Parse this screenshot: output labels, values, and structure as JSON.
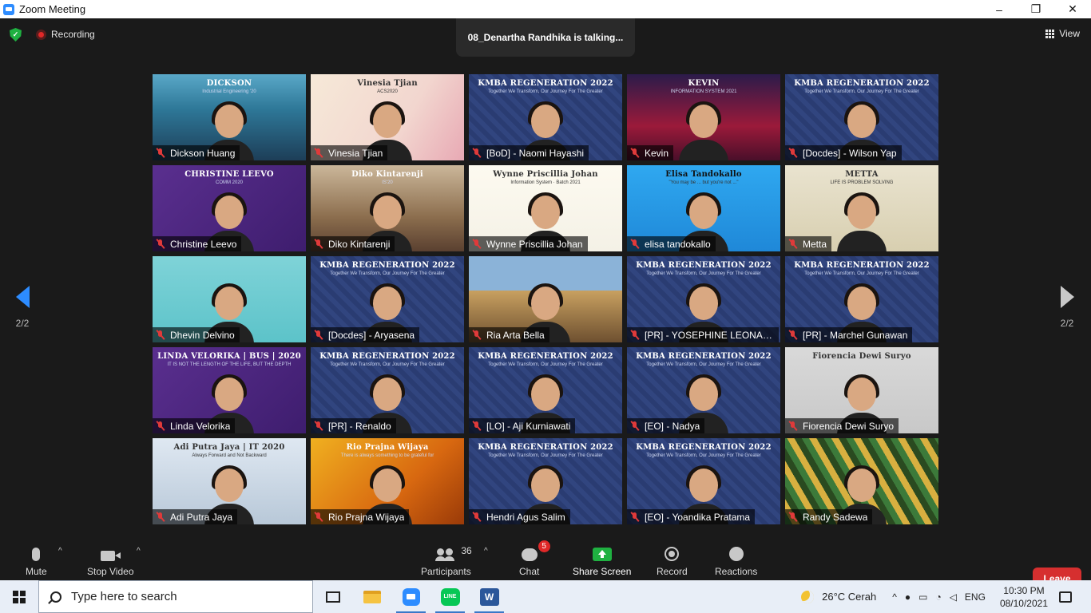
{
  "window": {
    "title": "Zoom Meeting",
    "controls": [
      "–",
      "❐",
      "✕"
    ]
  },
  "topbar": {
    "recording_label": "Recording",
    "talking_indicator": "08_Denartha Randhika is talking...",
    "view_label": "View"
  },
  "pagination": {
    "left_page": "2/2",
    "right_page": "2/2"
  },
  "participants": [
    {
      "name": "Dickson Huang",
      "style": "dickson",
      "banner": "DICKSON",
      "sub": "Industrial Engineering '20"
    },
    {
      "name": "Vinesia Tjian",
      "style": "vinesia",
      "banner": "Vinesia Tjian",
      "sub": "ACS2020"
    },
    {
      "name": "[BoD] - Naomi Hayashi",
      "style": "kmba",
      "banner": "KMBA REGENERATION 2022",
      "sub": "Together We Transform, Our Journey For The Greater"
    },
    {
      "name": "Kevin",
      "style": "kevin",
      "banner": "KEVIN",
      "sub": "INFORMATION SYSTEM 2021"
    },
    {
      "name": "[Docdes] - Wilson Yap",
      "style": "kmba",
      "banner": "KMBA REGENERATION 2022",
      "sub": "Together We Transform, Our Journey For The Greater"
    },
    {
      "name": "Christine Leevo",
      "style": "christine",
      "banner": "CHRISTINE LEEVO",
      "sub": "COMM 2020"
    },
    {
      "name": "Diko Kintarenji",
      "style": "diko",
      "banner": "Diko Kintarenji",
      "sub": "IS'20"
    },
    {
      "name": "Wynne Priscillia Johan",
      "style": "wynne",
      "banner": "Wynne Priscillia Johan",
      "sub": "Information System · Batch 2021"
    },
    {
      "name": "elisa tandokallo",
      "style": "elisa",
      "banner": "Elisa Tandokallo",
      "sub": "\"You may be ... but you're not ...\""
    },
    {
      "name": "Metta",
      "style": "metta",
      "banner": "METTA",
      "sub": "LIFE IS PROBLEM SOLVING"
    },
    {
      "name": "Dhevin Delvino",
      "style": "dhevin",
      "banner": "",
      "sub": ""
    },
    {
      "name": "[Docdes] - Aryasena",
      "style": "kmba",
      "banner": "KMBA REGENERATION 2022",
      "sub": "Together We Transform, Our Journey For The Greater"
    },
    {
      "name": "Ria Arta Bella",
      "style": "ria",
      "banner": "",
      "sub": ""
    },
    {
      "name": "[PR] - YOSEPHINE LEONAR...",
      "style": "kmba",
      "banner": "KMBA REGENERATION 2022",
      "sub": "Together We Transform, Our Journey For The Greater"
    },
    {
      "name": "[PR] - Marchel Gunawan",
      "style": "kmba",
      "banner": "KMBA REGENERATION 2022",
      "sub": "Together We Transform, Our Journey For The Greater"
    },
    {
      "name": "Linda Velorika",
      "style": "linda",
      "banner": "LINDA VELORIKA | BUS | 2020",
      "sub": "IT IS NOT THE LENGTH OF THE LIFE, BUT THE DEPTH"
    },
    {
      "name": "[PR] - Renaldo",
      "style": "kmba",
      "banner": "KMBA REGENERATION 2022",
      "sub": "Together We Transform, Our Journey For The Greater"
    },
    {
      "name": "[LO] - Aji Kurniawati",
      "style": "kmba",
      "banner": "KMBA REGENERATION 2022",
      "sub": "Together We Transform, Our Journey For The Greater"
    },
    {
      "name": "[EO] - Nadya",
      "style": "kmba",
      "banner": "KMBA REGENERATION 2022",
      "sub": "Together We Transform, Our Journey For The Greater"
    },
    {
      "name": "Fiorencia Dewi Suryo",
      "style": "fiorencia",
      "banner": "Fiorencia Dewi Suryo",
      "sub": ""
    },
    {
      "name": "Adi Putra Jaya",
      "style": "adi",
      "banner": "Adi Putra Jaya | IT 2020",
      "sub": "Always Forward and Not Backward"
    },
    {
      "name": "Rio Prajna Wijaya",
      "style": "rio",
      "banner": "Rio Prajna Wijaya",
      "sub": "There is always something to be grateful for"
    },
    {
      "name": "Hendri Agus Salim",
      "style": "kmba",
      "banner": "KMBA REGENERATION 2022",
      "sub": "Together We Transform, Our Journey For The Greater"
    },
    {
      "name": "[EO] - Yoandika Pratama",
      "style": "kmba",
      "banner": "KMBA REGENERATION 2022",
      "sub": "Together We Transform, Our Journey For The Greater"
    },
    {
      "name": "Randy Sadewa",
      "style": "randy",
      "banner": "",
      "sub": ""
    }
  ],
  "toolbar": {
    "mute_label": "Mute",
    "stop_video_label": "Stop Video",
    "participants_label": "Participants",
    "participants_count": "36",
    "chat_label": "Chat",
    "chat_badge": "5",
    "share_label": "Share Screen",
    "record_label": "Record",
    "reactions_label": "Reactions",
    "leave_label": "Leave",
    "caret": "^"
  },
  "taskbar": {
    "search_placeholder": "Type here to search",
    "weather": "26°C  Cerah",
    "language": "ENG",
    "time": "10:30 PM",
    "date": "08/10/2021",
    "apps": [
      "task-view",
      "file-explorer",
      "zoom",
      "line",
      "word"
    ]
  },
  "colors": {
    "accent": "#2d8cff",
    "share_green": "#1fb141",
    "leave_red": "#d62f2f",
    "mute_red": "#e03a3a",
    "meeting_bg": "#1a1a1a"
  }
}
